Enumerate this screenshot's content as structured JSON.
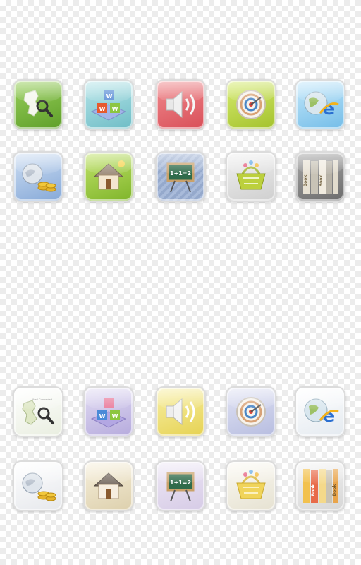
{
  "colors": {
    "map_green": "#7dba3e",
    "blocks_blue": "#8fd0d8",
    "speaker_red": "#e8636b",
    "target_lime": "#b8d63c",
    "ie_sky": "#9ed4f0",
    "money_blue": "#a9c4e6",
    "home_green": "#9ccc3a",
    "board_blue": "#9fb2d4",
    "basket_gray": "#e2e2e2",
    "books_gray": "#8f8f8f",
    "map_light": "#f0f3e6",
    "blocks_lilac": "#c9c0e6",
    "speaker_yellow": "#f2e47a",
    "target_lilac": "#c9cde8",
    "ie_white": "#f4f7fa",
    "money_white": "#f4f5f7",
    "home_beige": "#efe6cf",
    "board_lilac": "#e4dcef",
    "basket_light": "#f2f0e8",
    "books_light": "#e9e9e9"
  },
  "icons": {
    "block_letters": [
      "W",
      "W",
      "W"
    ],
    "chalkboard_text": "1+1=2",
    "book_spine_text": "Book",
    "browser_letter": "e",
    "map_card_caption": "Well Connected"
  }
}
